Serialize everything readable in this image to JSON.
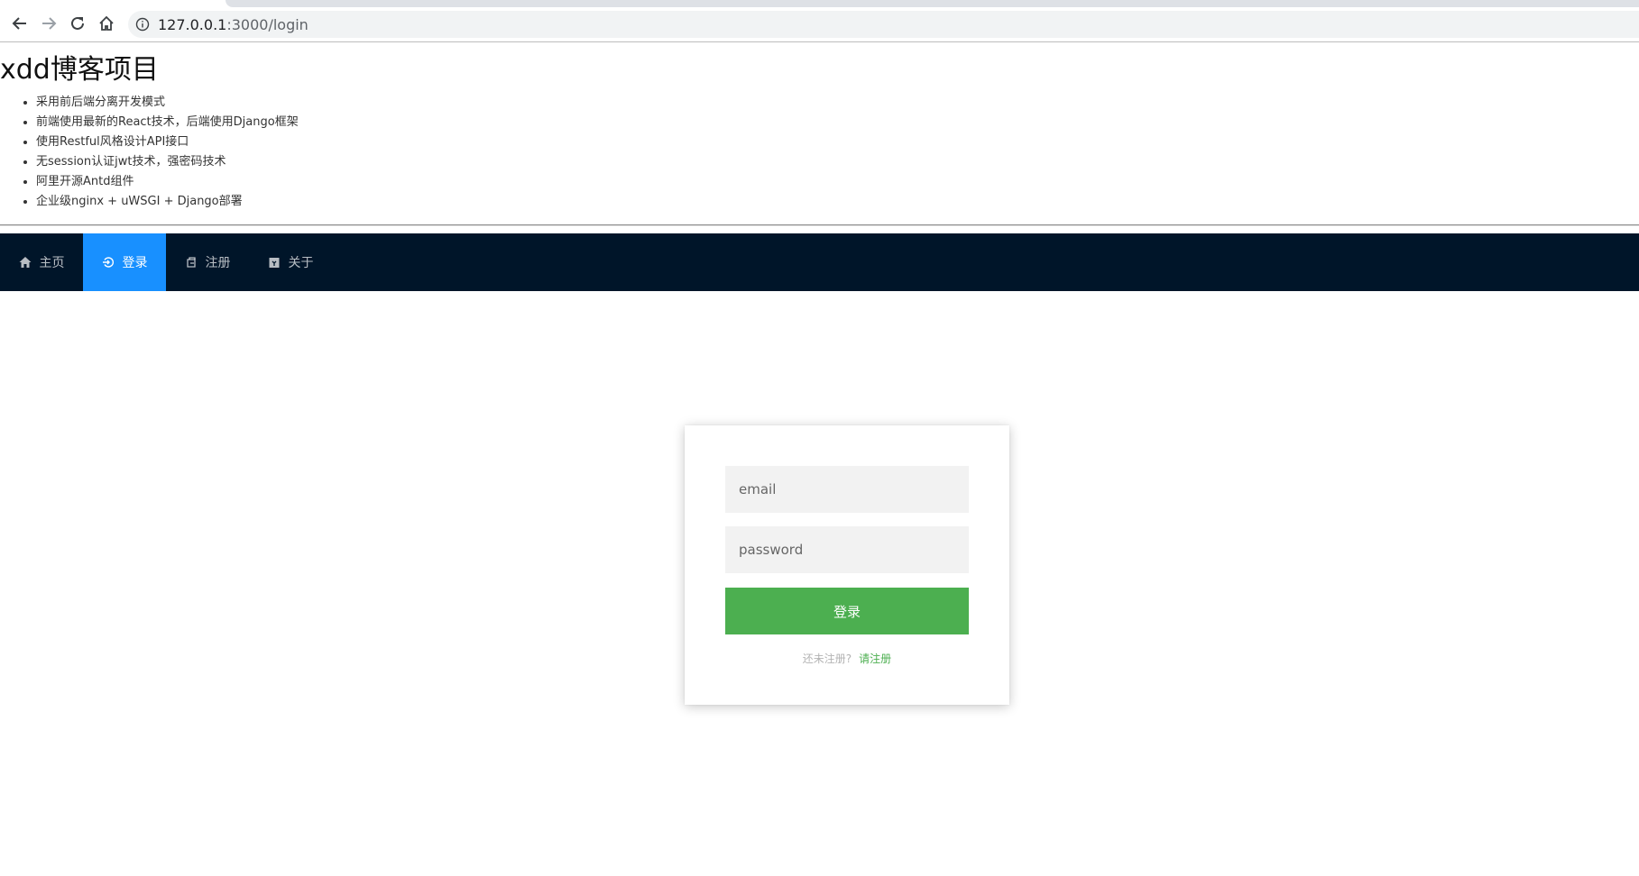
{
  "browser": {
    "url_host": "127.0.0.1",
    "url_path": ":3000/login"
  },
  "header": {
    "title": "xdd博客项目",
    "features": [
      "采用前后端分离开发模式",
      "前端使用最新的React技术，后端使用Django框架",
      "使用Restful风格设计API接口",
      "无session认证jwt技术，强密码技术",
      "阿里开源Antd组件",
      "企业级nginx + uWSGI + Django部署"
    ]
  },
  "menu": {
    "items": [
      {
        "label": "主页",
        "icon": "home-icon"
      },
      {
        "label": "登录",
        "icon": "login-icon",
        "active": true
      },
      {
        "label": "注册",
        "icon": "register-icon"
      },
      {
        "label": "关于",
        "icon": "about-icon"
      }
    ]
  },
  "login": {
    "email_placeholder": "email",
    "password_placeholder": "password",
    "submit_label": "登录",
    "register_prompt": "还未注册?",
    "register_link": "请注册"
  },
  "colors": {
    "menu_bg": "#001529",
    "menu_active": "#1890ff",
    "primary_button": "#4caf50"
  }
}
